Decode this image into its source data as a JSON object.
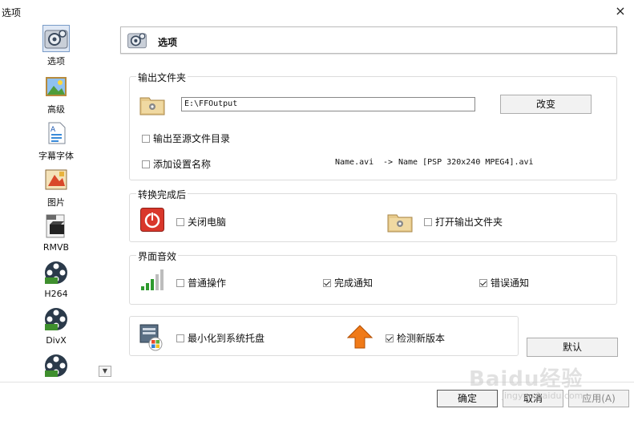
{
  "window": {
    "title": "选项",
    "close_glyph": "×"
  },
  "sidebar": {
    "items": [
      {
        "label": "选项",
        "icon": "options-gear-icon"
      },
      {
        "label": "高级",
        "icon": "advanced-landscape-icon"
      },
      {
        "label": "字幕字体",
        "icon": "subtitle-font-icon"
      },
      {
        "label": "图片",
        "icon": "picture-icon"
      },
      {
        "label": "RMVB",
        "icon": "rmvb-icon"
      },
      {
        "label": "H264",
        "icon": "h264-film-icon"
      },
      {
        "label": "DivX",
        "icon": "divx-film-icon"
      },
      {
        "label": "",
        "icon": "film-icon"
      }
    ]
  },
  "header": {
    "title": "选项"
  },
  "output_folder": {
    "group_title": "输出文件夹",
    "path_value": "E:\\FFOutput",
    "change_button": "改变",
    "to_source_dir": "输出至源文件目录",
    "add_setting_name": "添加设置名称",
    "example_from": "Name.avi",
    "example_arrow": "->",
    "example_to": "Name [PSP 320x240 MPEG4].avi"
  },
  "after_convert": {
    "group_title": "转换完成后",
    "shutdown": "关闭电脑",
    "open_output": "打开输出文件夹"
  },
  "ui_sound": {
    "group_title": "界面音效",
    "normal_op": "普通操作",
    "done_notify": "完成通知",
    "error_notify": "错误通知"
  },
  "misc": {
    "minimize_tray": "最小化到系统托盘",
    "check_update": "检测新版本",
    "default_button": "默认"
  },
  "footer": {
    "ok": "确定",
    "cancel": "取消",
    "apply": "应用(A)"
  },
  "watermark": {
    "main": "Baidu经验",
    "sub": "jingyan.baidu.com"
  },
  "colors": {
    "selection": "#dfe8f5",
    "shutdown_red": "#d9372b",
    "update_orange": "#f07a18",
    "folder_tan": "#e6c98a"
  }
}
